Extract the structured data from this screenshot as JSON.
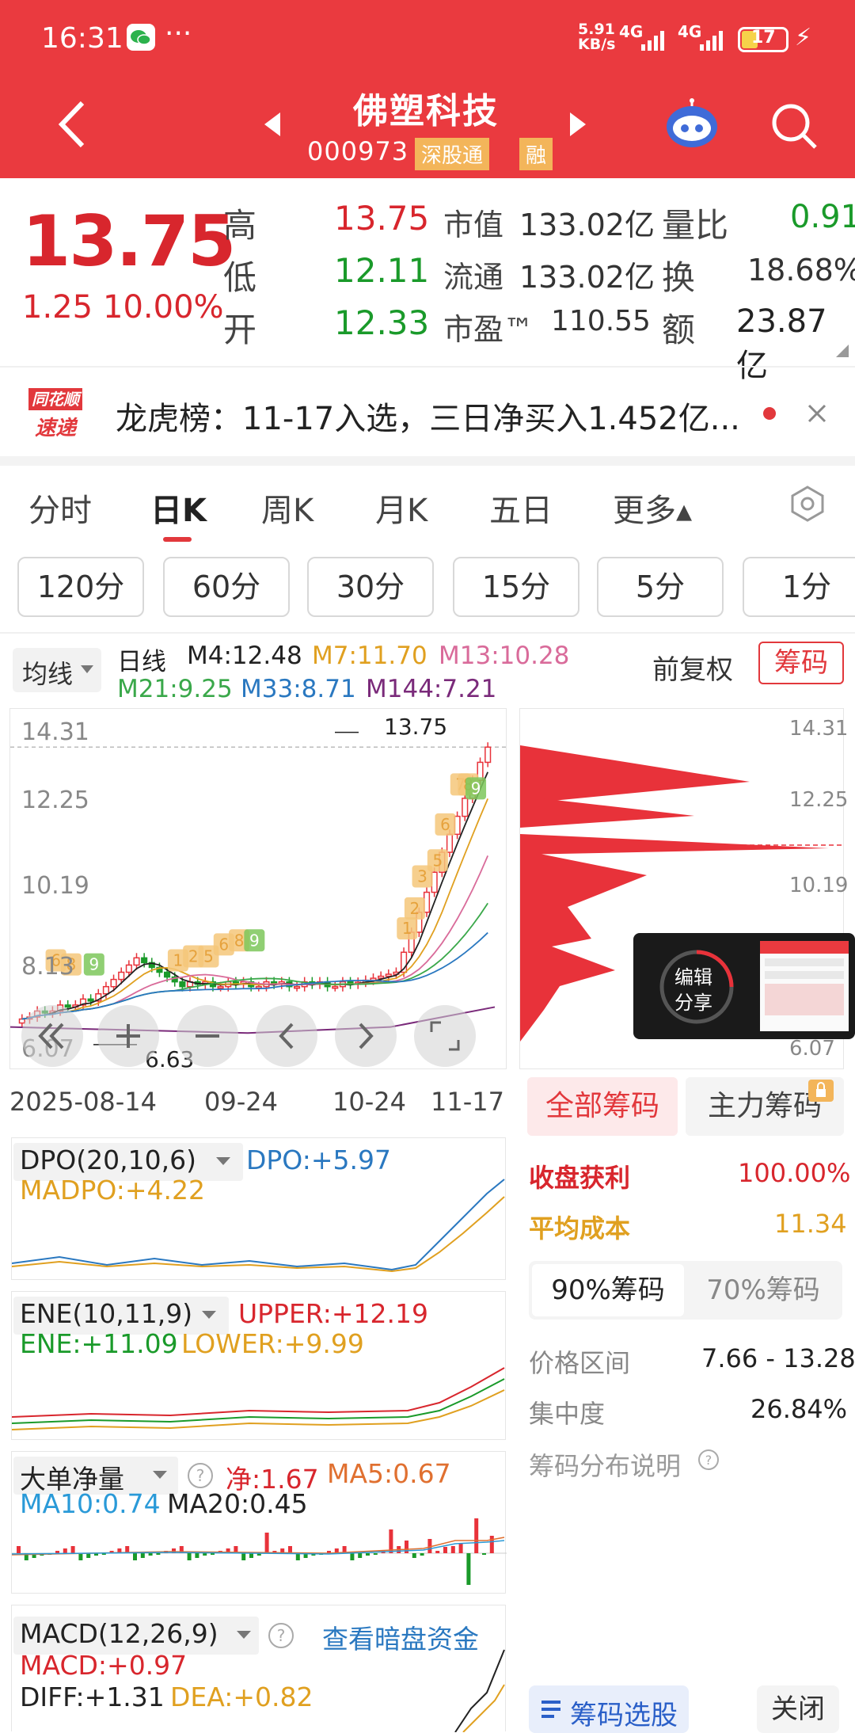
{
  "status": {
    "time": "16:31",
    "dots": "···",
    "speed_top": "5.91",
    "speed_bot": "KB/s",
    "net1": "4G",
    "net2": "4G",
    "battery": "17"
  },
  "header": {
    "stock_name": "佛塑科技",
    "code": "000973",
    "badge": "深股通",
    "badge2": "融"
  },
  "quote": {
    "price": "13.75",
    "change": "1.25",
    "change_pct": "10.00%",
    "labels": {
      "high": "高",
      "low": "低",
      "open": "开",
      "mcap": "市值",
      "float": "流通",
      "pe": "市盈™",
      "vol_ratio": "量比",
      "turnover": "换",
      "amount": "额"
    },
    "high": "13.75",
    "low": "12.11",
    "open": "12.33",
    "mcap": "133.02亿",
    "float": "133.02亿",
    "pe": "110.55",
    "vol_ratio": "0.91",
    "turnover": "18.68%",
    "amount": "23.87亿"
  },
  "news": {
    "logo_top": "同花顺",
    "logo_bot": "速递",
    "text": "龙虎榜：11-17入选，三日净买入1.452亿..."
  },
  "tabs": [
    "分时",
    "日K",
    "周K",
    "月K",
    "五日",
    "更多▴"
  ],
  "periods": [
    "120分",
    "60分",
    "30分",
    "15分",
    "5分",
    "1分"
  ],
  "ma": {
    "selector": "均线",
    "period": "日线",
    "m4": "M4:12.48",
    "m7": "M7:11.70",
    "m13": "M13:10.28",
    "m21": "M21:9.25",
    "m33": "M33:8.71",
    "m144": "M144:7.21",
    "adjust": "前复权",
    "chip_btn": "筹码"
  },
  "kline": {
    "y_ticks": [
      "14.31",
      "12.25",
      "10.19",
      "8.13",
      "6.07"
    ],
    "max_label": "13.75",
    "min_label": "6.63",
    "dates": [
      "2025-08-14",
      "09-24",
      "10-24",
      "11-17"
    ]
  },
  "chip_axis": [
    "14.31",
    "12.25",
    "10.19",
    "6.07"
  ],
  "share": {
    "line1": "编辑",
    "line2": "分享"
  },
  "dpo": {
    "name": "DPO(20,10,6)",
    "dpo": "DPO:+5.97",
    "madpo": "MADPO:+4.22"
  },
  "ene": {
    "name": "ENE(10,11,9)",
    "upper": "UPPER:+12.19",
    "ene": "ENE:+11.09",
    "lower": "LOWER:+9.99"
  },
  "big": {
    "name": "大单净量",
    "net": "净:1.67",
    "ma5": "MA5:0.67",
    "ma10": "MA10:0.74",
    "ma20": "MA20:0.45"
  },
  "macd": {
    "name": "MACD(12,26,9)",
    "link": "查看暗盘资金",
    "macd": "MACD:+0.97",
    "diff": "DIFF:+1.31",
    "dea": "DEA:+0.82"
  },
  "chips": {
    "tab_all": "全部筹码",
    "tab_main": "主力筹码",
    "profit_label": "收盘获利",
    "profit": "100.00%",
    "avg_label": "平均成本",
    "avg": "11.34",
    "c90": "90%筹码",
    "c70": "70%筹码",
    "range_label": "价格区间",
    "range": "7.66 - 13.28",
    "conc_label": "集中度",
    "conc": "26.84%",
    "explain": "筹码分布说明",
    "select_btn": "筹码选股",
    "close_btn": "关闭"
  },
  "colors": {
    "header_red": "#ea3a3f",
    "up": "#d8262d",
    "down": "#1a9a2a"
  }
}
